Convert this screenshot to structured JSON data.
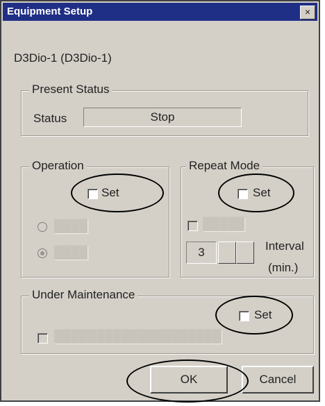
{
  "window": {
    "title": "Equipment Setup",
    "close": "×"
  },
  "device": {
    "label": "D3Dio-1  (D3Dio-1)"
  },
  "present_status": {
    "legend": "Present Status",
    "status_label": "Status",
    "status_value": "Stop"
  },
  "operation": {
    "legend": "Operation",
    "set_label": "Set",
    "set_checked": false
  },
  "repeat_mode": {
    "legend": "Repeat Mode",
    "set_label": "Set",
    "set_checked": false,
    "interval_value": "3",
    "interval_label": "Interval",
    "interval_unit": "(min.)"
  },
  "maintenance": {
    "legend": "Under Maintenance",
    "set_label": "Set",
    "set_checked": false
  },
  "buttons": {
    "ok": "OK",
    "cancel": "Cancel"
  },
  "colors": {
    "title_bar": "#1f2f86",
    "dialog_bg": "#d4d0c8",
    "annotation": "#000000"
  }
}
